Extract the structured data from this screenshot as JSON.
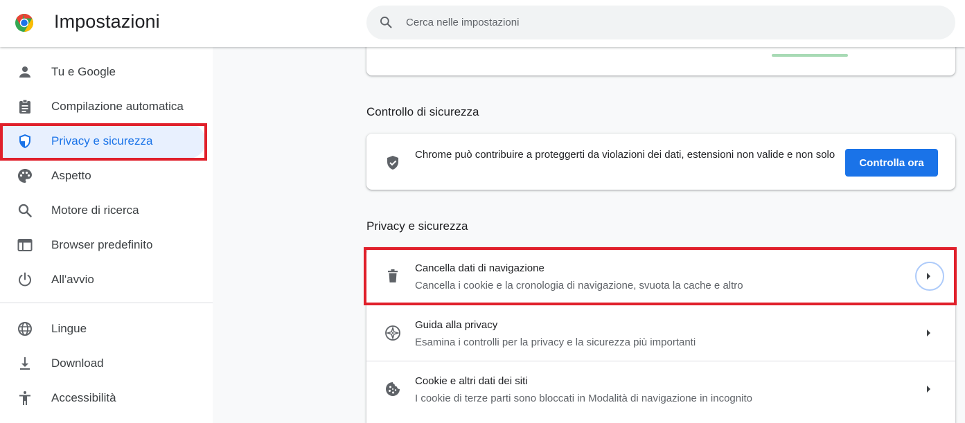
{
  "app": {
    "title": "Impostazioni"
  },
  "search": {
    "placeholder": "Cerca nelle impostazioni"
  },
  "sidebar": {
    "items": [
      {
        "label": "Tu e Google",
        "icon": "person-icon"
      },
      {
        "label": "Compilazione automatica",
        "icon": "clipboard-icon"
      },
      {
        "label": "Privacy e sicurezza",
        "icon": "shield-icon",
        "active": true
      },
      {
        "label": "Aspetto",
        "icon": "palette-icon"
      },
      {
        "label": "Motore di ricerca",
        "icon": "search-icon"
      },
      {
        "label": "Browser predefinito",
        "icon": "browser-window-icon"
      },
      {
        "label": "All'avvio",
        "icon": "power-icon"
      },
      {
        "label": "Lingue",
        "icon": "globe-icon"
      },
      {
        "label": "Download",
        "icon": "download-icon"
      },
      {
        "label": "Accessibilità",
        "icon": "accessibility-icon"
      }
    ]
  },
  "safety_check": {
    "heading": "Controllo di sicurezza",
    "text": "Chrome può contribuire a proteggerti da violazioni dei dati, estensioni non valide e non solo",
    "button_label": "Controlla ora"
  },
  "privacy": {
    "heading": "Privacy e sicurezza",
    "rows": [
      {
        "title": "Cancella dati di navigazione",
        "subtitle": "Cancella i cookie e la cronologia di navigazione, svuota la cache e altro",
        "icon": "trash-icon"
      },
      {
        "title": "Guida alla privacy",
        "subtitle": "Esamina i controlli per la privacy e la sicurezza più importanti",
        "icon": "compass-icon"
      },
      {
        "title": "Cookie e altri dati dei siti",
        "subtitle": "I cookie di terze parti sono bloccati in Modalità di navigazione in incognito",
        "icon": "cookie-icon"
      }
    ]
  },
  "colors": {
    "accent": "#1a73e8",
    "active_bg": "#e8f0fe",
    "highlight": "#e0202b"
  }
}
